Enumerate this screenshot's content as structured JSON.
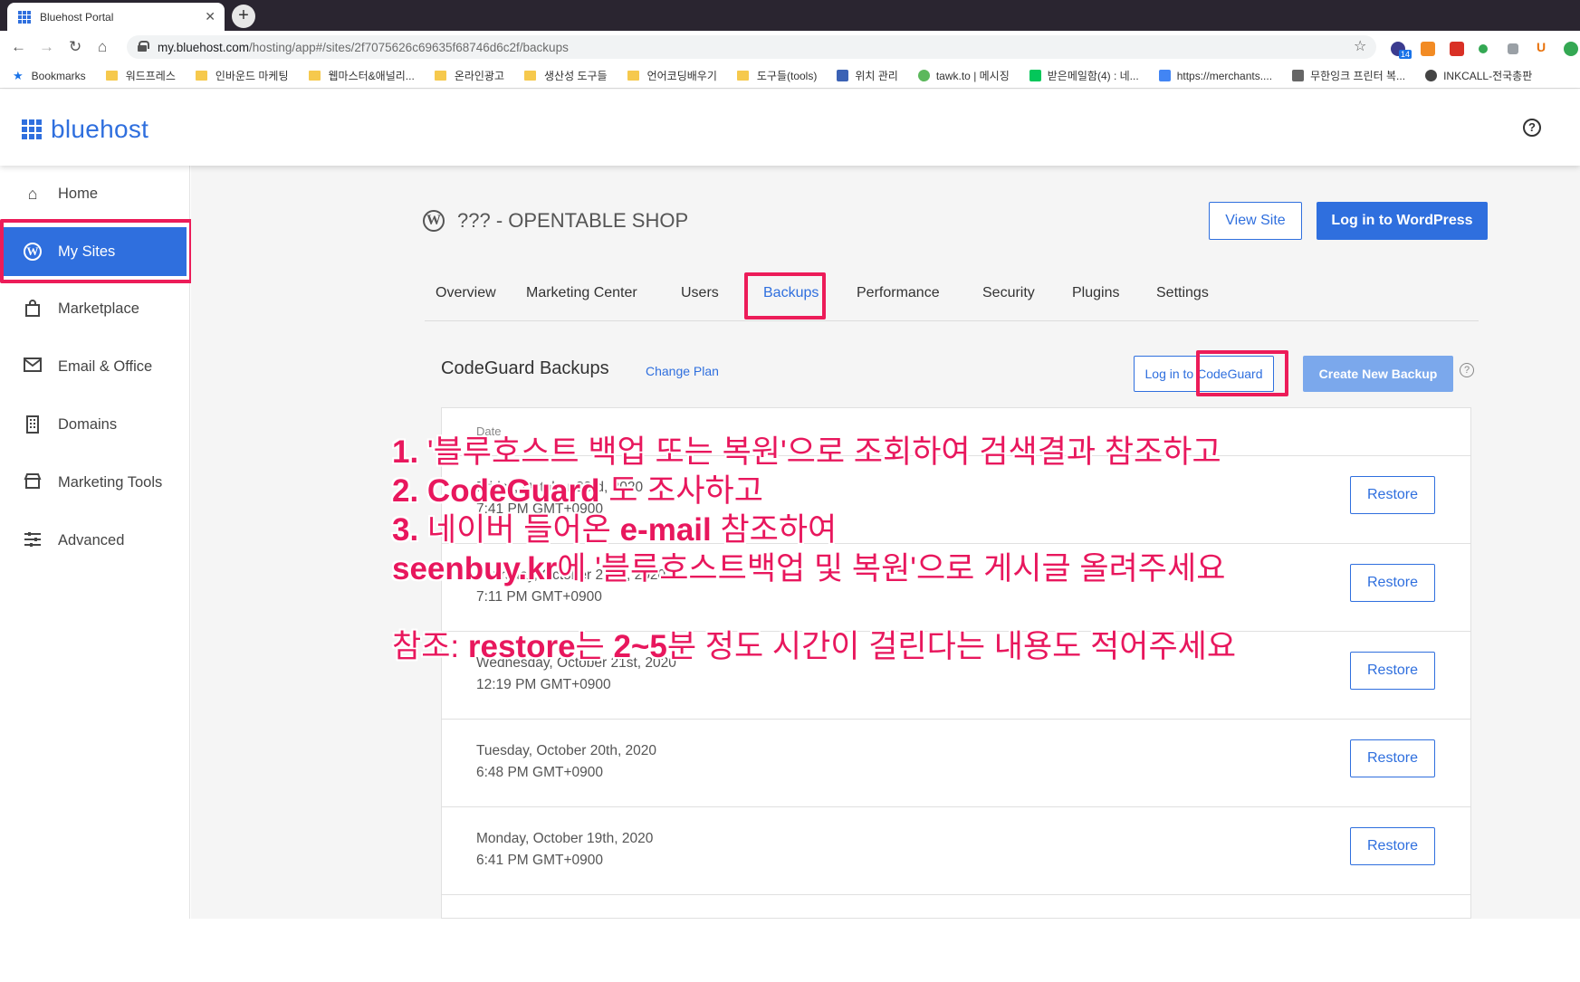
{
  "browser": {
    "tab_title": "Bluehost Portal",
    "tab_close": "✕",
    "new_tab": "+",
    "url_host": "my.bluehost.com",
    "url_path": "/hosting/app#/sites/2f7075626c69635f68746d6c2f/backups",
    "bookmarks": [
      "Bookmarks",
      "워드프레스",
      "인바운드 마케팅",
      "웹마스터&애널리...",
      "온라인광고",
      "생산성 도구들",
      "언어코딩배우기",
      "도구들(tools)",
      "위치 관리",
      "tawk.to | 메시징",
      "받은메일함(4) : 네...",
      "https://merchants....",
      "무한잉크 프린터 복...",
      "INKCALL-전국총판"
    ],
    "extension_badge": "14"
  },
  "header": {
    "logo_text": "bluehost",
    "help": "?"
  },
  "sidebar": {
    "items": [
      {
        "label": "Home",
        "icon": "home-icon"
      },
      {
        "label": "My Sites",
        "icon": "wordpress-icon"
      },
      {
        "label": "Marketplace",
        "icon": "shopping-bag-icon"
      },
      {
        "label": "Email & Office",
        "icon": "mail-icon"
      },
      {
        "label": "Domains",
        "icon": "building-icon"
      },
      {
        "label": "Marketing Tools",
        "icon": "store-icon"
      },
      {
        "label": "Advanced",
        "icon": "sliders-icon"
      }
    ]
  },
  "site": {
    "title": "??? - OPENTABLE SHOP",
    "view_site": "View Site",
    "login_wp": "Log in to WordPress"
  },
  "tabs": [
    "Overview",
    "Marketing Center",
    "Users",
    "Backups",
    "Performance",
    "Security",
    "Plugins",
    "Settings"
  ],
  "backups": {
    "title": "CodeGuard Backups",
    "change_plan": "Change Plan",
    "login_codeguard": "Log in to CodeGuard",
    "create_backup": "Create New Backup",
    "help": "?",
    "column_date": "Date",
    "restore_label": "Restore",
    "rows": [
      {
        "date": "Friday, October 23rd, 2020",
        "time": "7:41 PM GMT+0900"
      },
      {
        "date": "Thursday, October 22nd, 2020",
        "time": "7:11 PM GMT+0900"
      },
      {
        "date": "Wednesday, October 21st, 2020",
        "time": "12:19 PM GMT+0900"
      },
      {
        "date": "Tuesday, October 20th, 2020",
        "time": "6:48 PM GMT+0900"
      },
      {
        "date": "Monday, October 19th, 2020",
        "time": "6:41 PM GMT+0900"
      }
    ]
  },
  "annotation": {
    "line1_num": "1.",
    "line1": " '블루호스트 백업 또는 복원'으로  조회하여 검색결과 참조하고",
    "line2_num": "2. CodeGuard",
    "line2": " 도 조사하고",
    "line3_num": "3.",
    "line3": " 네이버 들어온 ",
    "line3_b": "e-mail",
    "line3_end": " 참조하여",
    "line4_b": "seenbuy.kr",
    "line4": "에 '블루호스트백업 및 복원'으로 게시글 올려주세요",
    "line5_a": "참조: ",
    "line5_b": "restore",
    "line5_c": "는 ",
    "line5_d": "2~5",
    "line5_e": "분 정도 시간이 걸린다는 내용도 적어주세요"
  },
  "colors": {
    "brand": "#2f6fde",
    "highlight": "#ec1c59",
    "annotation": "#e8175d"
  }
}
